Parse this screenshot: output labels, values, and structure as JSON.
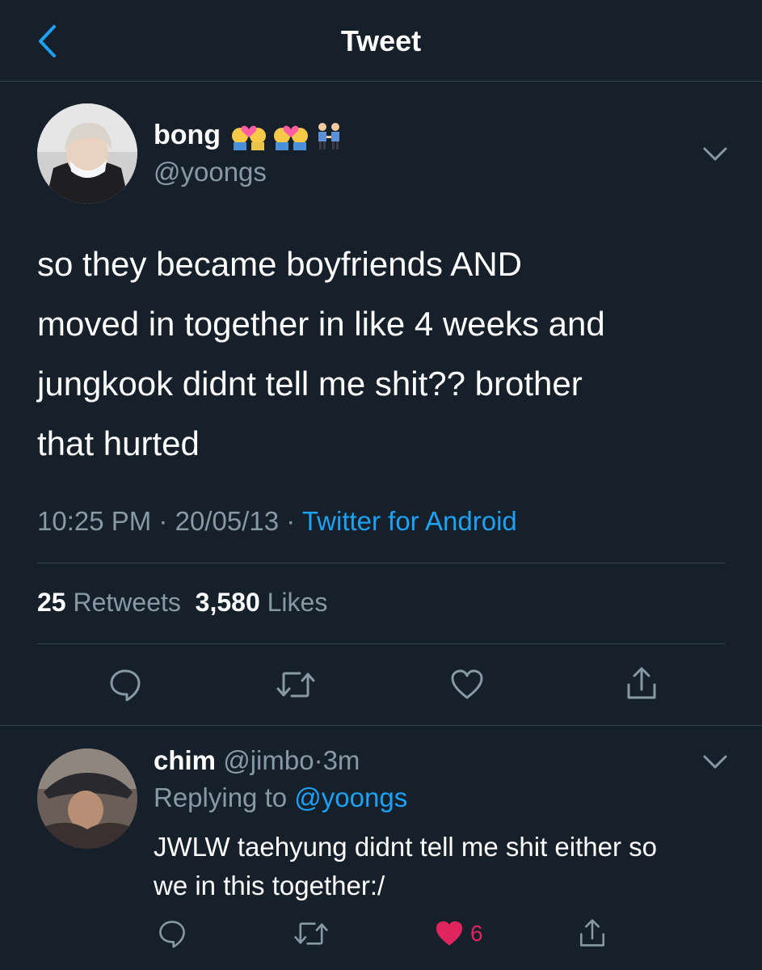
{
  "header": {
    "title": "Tweet"
  },
  "tweet": {
    "author": {
      "name": "bong",
      "handle": "@yoongs"
    },
    "text": "so they became boyfriends AND\nmoved in together in like 4 weeks and\njungkook didnt tell me shit?? brother\nthat hurted",
    "time": "10:25 PM",
    "date": "20/05/13",
    "separator": "·",
    "source": "Twitter for Android",
    "stats": {
      "retweets": "25",
      "retweets_label": "Retweets",
      "likes": "3,580",
      "likes_label": "Likes"
    },
    "actions": [
      "reply-icon",
      "retweet-icon",
      "like-icon",
      "share-icon"
    ]
  },
  "reply": {
    "author": {
      "name": "chim",
      "handle": "@jimbo"
    },
    "separator": "·",
    "time": "3m",
    "replying_prefix": "Replying to",
    "replying_to": "@yoongs",
    "text": "JWLW taehyung didnt tell me shit either so\nwe in this together:/",
    "like_count": "6",
    "liked": true
  },
  "colors": {
    "background": "#15202b",
    "secondary_text": "#8899a6",
    "accent": "#1da1f2",
    "liked": "#e0245e",
    "divider": "#38444d"
  }
}
